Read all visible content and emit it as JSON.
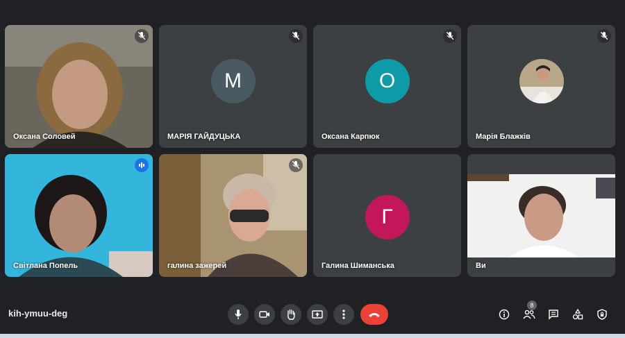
{
  "participants": [
    {
      "name": "Оксана Соловей",
      "type": "video",
      "muted": true
    },
    {
      "name": "МАРІЯ ГАЙДУЦЬКА",
      "type": "initial",
      "initial": "M",
      "color": "#4a5a63",
      "muted": true
    },
    {
      "name": "Оксана Карпюк",
      "type": "initial",
      "initial": "O",
      "color": "#0f9aa8",
      "muted": true
    },
    {
      "name": "Марія Блажків",
      "type": "photo",
      "muted": true
    },
    {
      "name": "Світлана Попель",
      "type": "video",
      "speaking": true
    },
    {
      "name": "галина зажерей",
      "type": "video",
      "muted": true
    },
    {
      "name": "Галина Шиманська",
      "type": "initial",
      "initial": "Г",
      "color": "#c2185b",
      "muted": false
    },
    {
      "name": "Ви",
      "type": "video",
      "muted": false
    }
  ],
  "controls": {
    "meeting_code": "kih-ymuu-deg",
    "participant_count": "8"
  },
  "colors": {
    "background": "#202124",
    "tile": "#3c4043",
    "end_call": "#ea4335",
    "speaking": "#1a73e8"
  },
  "icons": [
    "mic-icon",
    "camera-icon",
    "hand-icon",
    "present-icon",
    "more-icon",
    "end-call-icon",
    "info-icon",
    "people-icon",
    "chat-icon",
    "activities-icon",
    "host-controls-icon",
    "mic-off-icon"
  ]
}
